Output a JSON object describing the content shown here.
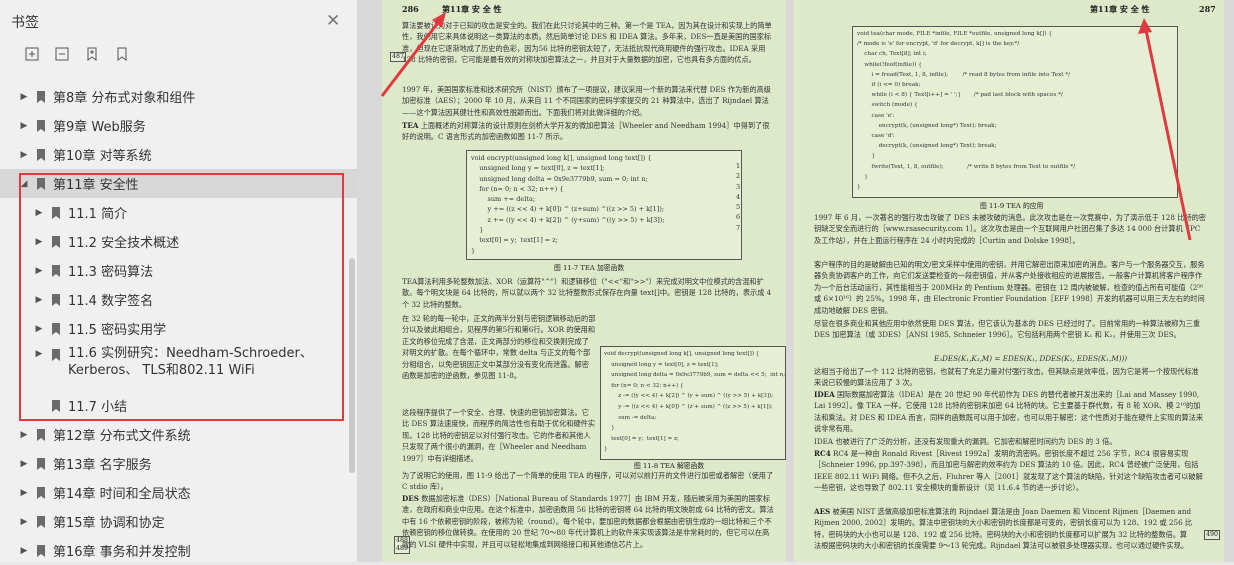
{
  "sidebar": {
    "title": "书签",
    "close_icon": "close-icon",
    "toolbar": [
      "expand-all-icon",
      "collapse-all-icon",
      "add-bookmark-icon",
      "bookmark-icon"
    ],
    "items": [
      {
        "label": "第8章 分布式对象和组件",
        "level": 1,
        "arrow": "▶"
      },
      {
        "label": "第9章 Web服务",
        "level": 1,
        "arrow": "▶"
      },
      {
        "label": "第10章 对等系统",
        "level": 1,
        "arrow": "▶"
      },
      {
        "label": "第11章 安全性",
        "level": 1,
        "arrow": "◢",
        "selected": true
      },
      {
        "label": "11.1 简介",
        "level": 2,
        "arrow": "▶"
      },
      {
        "label": "11.2 安全技术概述",
        "level": 2,
        "arrow": "▶"
      },
      {
        "label": "11.3 密码算法",
        "level": 2,
        "arrow": "▶"
      },
      {
        "label": "11.4 数字签名",
        "level": 2,
        "arrow": "▶"
      },
      {
        "label": "11.5 密码实用学",
        "level": 2,
        "arrow": "▶"
      },
      {
        "label": "11.6 实例研究：Needham-Schroeder、Kerberos、 TLS和802.11 WiFi",
        "level": 2,
        "arrow": "▶",
        "twoline": true
      },
      {
        "label": "11.7 小结",
        "level": 2,
        "arrow": ""
      },
      {
        "label": "第12章 分布式文件系统",
        "level": 1,
        "arrow": "▶"
      },
      {
        "label": "第13章 名字服务",
        "level": 1,
        "arrow": "▶"
      },
      {
        "label": "第14章 时间和全局状态",
        "level": 1,
        "arrow": "▶"
      },
      {
        "label": "第15章 协调和协定",
        "level": 1,
        "arrow": "▶"
      },
      {
        "label": "第16章 事务和并发控制",
        "level": 1,
        "arrow": "▶"
      }
    ]
  },
  "doc": {
    "left": {
      "header_num": "286",
      "header_title": "第11章  安 全 性",
      "margin_tag_top": "487",
      "margin_tag_bottom": "488\n489",
      "p1": "算法要被认为对于已知的攻击是安全的。我们在此只讨论其中的三种。第一个是 TEA，因为其在设计和实现上的简单性，我们用它来具体说明这一类算法的本质。然后简单讨论 DES 和 IDEA 算法。多年来，DES一直是美国的国家标准，但现在它逐渐地成了历史的色彩，因为56 比特的密钥太短了，无法抵抗现代商用硬件的强行攻击。IDEA 采用 128 比特的密钥，它可能是最有效的对称块加密算法之一，并且对于大量数据的加密，它也具有多方面的优点。",
      "p2": "1997 年，美国国家标准和技术研究所（NIST）颁布了一项提议，建议采用一个新的算法来代替 DES 作为新的高级加密标准（AES）；2000 年 10 月，从来自 11 个不同国家的密码学家提交的 21 种算法中，选出了 Rijndael 算法——这个算法因其健壮性和高效性脱颖而出。下面我们将对此做详细的介绍。",
      "p3_head": "TEA",
      "p3": "上面概述的对称算法的设计原则在剑桥大学开发的微加密算法［Wheeler and Needham 1994］中得到了很好的说明。C 语言形式的加密函数如图 11-7 所示。",
      "code1": "void encrypt(unsigned long k[], unsigned long text[]) {\n    unsigned long y = text[0], z = text[1];\n    unsigned long delta = 0x9e3779b9, sum = 0; int n;\n    for (n= 0; n < 32; n++) {\n        sum += delta;\n        y += ((z << 4) + k[0]) ^ (z+sum) ^((z >> 5) + k[1]);\n        z += ((y << 4) + k[2]) ^ (y+sum) ^((y >> 5) + k[3]);\n    }\n    text[0] = y;  text[1] = z;\n}",
      "code1_lines": "1\n2\n3\n4\n5\n6\n7",
      "cap1": "图 11-7    TEA 加密函数",
      "p4": "TEA算法利用多轮整数加法、XOR（运算符\"^\"）和逻辑移位（\"<<\"和\">>\"）来完成对明文中位模式的含混和扩散。每个明文块是 64 比特的，所以就以两个 32 比特整数形式保存在向量 text[]中。密钥是 128 比特的，表示成 4 个 32 比特的整数。",
      "p5": "在 32 轮的每一轮中，正文的两半分别与密钥逻辑移动后的部分以及彼此相组合，见程序的第5行和第6行。XOR 的使用和正文的移位完成了含混，正文两部分的移位和交换则完成了对明文的扩散。在每个循环中，常数 delta 与正文的每个部分相组合，以免密钥因正文中某部分没有变化而泄露。解密函数是加密的逆函数，参见图 11-8。",
      "p6": "这段程序提供了一个安全、合理、快速的密钥加密算法。它比 DES 算法速度快，而程序的简洁性也有助于优化和硬件实现。128 比特的密钥足以对付强行攻击。它的作者和其他人只发现了两个很小的漏洞，在［Wheeler and Needham 1997］中有详细描述。",
      "code2": "void decrypt(unsigned long k[], unsigned long text[]) {\n    unsigned long y = text[0], z = text[1];\n    unsigned long delta = 0x9e3779b9, sum = delta << 5;  int n;\n    for (n= 0; n < 32; n++) {\n        z -= ((y << 4) + k[2]) ^ (y + sum) ^ ((y >> 5) + k[3]);\n        y -= ((z << 4) + k[0]) ^ (z + sum) ^ ((z >> 5) + k[1]);\n        sum -= delta;\n    }\n    text[0] = y;  text[1] = z;\n}",
      "cap2": "图 11-8    TEA 解密函数",
      "p7": "为了说明它的使用，图 11-9 给出了一个简单的使用 TEA 的程序，可以对以前打开的文件进行加密或者解密（使用了 C stdio 库）。",
      "p8_head": "DES",
      "p8": "数据加密标准（DES）［National Bureau of Standards 1977］由 IBM 开发，随后被采用为美国的国家标准，在政府和商业中应用。在这个标准中，加密函数用 56 比特的密钥将 64 比特的明文映射成 64 比特的密文。算法中有 16 个依赖密钥的阶段，被称为轮（round）。每个轮中，要加密的数据都会根据由密钥生成的一组比特和三个不依赖密钥的移位做转换。在使用的 20 世纪 70～80 年代计算机上的软件来实现该算法是非常耗时的，但它可以在高效的 VLSI 硬件中实现，并且可以轻松地集成到网络接口和其他通信芯片上。"
    },
    "right": {
      "header_title": "第11章  安 全 性",
      "header_num": "287",
      "margin_tag": "490",
      "code3": "void tea(char mode, FILE *infile, FILE *outfile, unsigned long k[]) {\n/* mode is 'e' for encrypt, 'd' for decrypt, k[] is the key.*/\n    char ch, Text[8]; int i;\n    while(!feof(infile)) {\n        i = fread(Text, 1, 8, infile);        /* read 8 bytes from infile into Text */\n        if (i <= 0) break;\n        while (i < 8) { Text[i++] = ' ';}       /* pad last block with spaces */\n        switch (mode) {\n        case 'e':\n            encrypt(k, (unsigned long*) Text); break;\n        case 'd':\n            decrypt(k, (unsigned long*) Text); break;\n        }\n        fwrite(Text, 1, 8, outfile);             /* write 8 bytes from Text to outfile */\n    }\n}",
      "cap3": "图 11-9    TEA 的应用",
      "p1": "1997 年 6 月，一次著名的强行攻击攻破了 DES 未被攻破的消息。此次攻击是在一次竞赛中，为了演示低于 128 比特的密钥缺乏安全而进行的［www.rsasecurity.com 1］。这次攻击是由一个互联网用户社团召集了多达 14 000 台计算机（PC 及工作站），并在上面运行程序在 24 小时内完成的［Curtin and Dolske 1998］。",
      "p2": "客户程序的目的是破解由已知的明文/密文采样中使用的密钥，并用它解密出原来加密的消息。客户与一个服务器交互，服务器负责协调客户的工作，向它们发送要检查的一段密钥值，并从客户处接收相应的进展报告。一般客户计算机将客户程序作为一个后台活动运行，其性能相当于 200MHz 的 Pentium 处理器。密钥在 12 周内被破解，检查的值占所有可能值（2⁵⁶或 6×10¹⁶）的 25%。1998 年，由 Electronic Frontier Foundation［EFF 1998］开发的机器可以用三天左右的时间成功地破解 DES 密钥。",
      "p3": "尽管在很多商业和其他应用中依然使用 DES 算法，但它该认为基本的 DES 已经过时了。目前常用的一种算法被称为三重 DES 加密算法（或 3DES）［ANSI 1985, Schneier 1996］。它包括利用两个密钥 K₁ 和 K₂，并使用三次 DES。",
      "formula": "E₃DES(K₁,K₂,M) = EDES(K₁, DDES(K₂, EDES(K₁,M)))",
      "p4": "这相当于给出了一个 112 比特的密钥，也就有了充足力量对付强行攻击。但其缺点是效率低，因为它是将一个按现代标准来说已较慢的算法应用了 3 次。",
      "p5_head": "IDEA",
      "p5": "国际数据加密算法（IDEA）是在 20 世纪 90 年代初作为 DES 的替代者被开发出来的［Lai and Massey 1990, Lai 1992］。像 TEA 一样，它使用 128 比特的密钥来加密 64 比特的块。它主要基于群代数，有 8 轮 XOR、模 2¹⁶的加法和乘法。对 DES 和 IDEA 而言，同样的函数既可以用于加密，也可以用于解密：这个性质对于能在硬件上实现的算法来说非常有用。",
      "p6": "IDEA 也被进行了广泛的分析，还没有发现重大的漏洞。它加密和解密时间约为 DES 的 3 倍。",
      "p7_head": "RC4",
      "p7": "RC4 是一种由 Ronald Rivest［Rivest 1992a］发明的流密码。密钥长度不超过 256 字节，RC4 很容易实现［Schneier 1996, pp.397-398］，而且加密与解密的效率约为 DES 算法的 10 倍。因此，RC4 曾经被广泛使用，包括 IEEE 802.11 WiFi 网络。但不久之后，Fluhrer 等人［2001］就发现了这个算法的缺陷，针对这个缺陷攻击者可以破解一些密钥，这也导致了 802.11 安全模块的重新设计（见 11.6.4 节的进一步讨论）。",
      "p8_head": "AES",
      "p8": "被美国 NIST 选做高级加密标准算法的 Rijndael 算法是由 Joan Daemen 和 Vincent Rijmen［Daemen and Rijmen 2000, 2002］发明的。算法中密钥块的大小和密钥的长度都是可变的，密钥长度可以为 128、192 或 256 比特，密码块的大小也可以是 128、192 或 256 比特。密码块的大小和密钥的长度都可以扩展为 32 比特的整数倍。算法根据密码块的大小和密钥的长度需要 9～13 轮完成。Rijndael 算法可以被很多处理器实现，也可以通过硬件实现。"
    }
  },
  "colors": {
    "highlight_box": "#e0393f",
    "page_background": "#dde9c8",
    "sidebar_background": "#f0f0f0"
  }
}
